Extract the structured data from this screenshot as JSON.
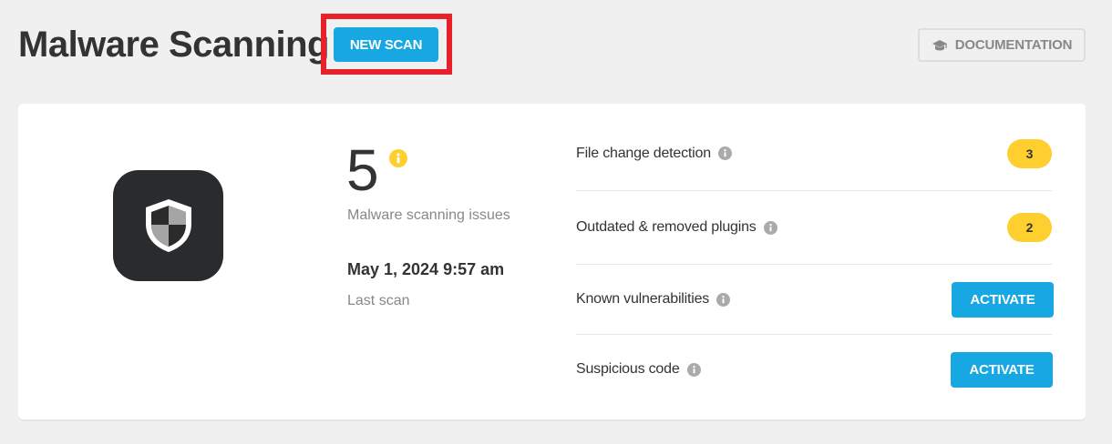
{
  "header": {
    "title": "Malware Scanning",
    "new_scan_label": "NEW SCAN",
    "documentation_label": "DOCUMENTATION"
  },
  "summary": {
    "issue_count": "5",
    "issues_label": "Malware scanning issues",
    "last_scan_date": "May 1, 2024 9:57 am",
    "last_scan_label": "Last scan"
  },
  "checks": [
    {
      "label": "File change detection",
      "badge": "3"
    },
    {
      "label": "Outdated & removed plugins",
      "badge": "2"
    },
    {
      "label": "Known vulnerabilities",
      "action": "ACTIVATE"
    },
    {
      "label": "Suspicious code",
      "action": "ACTIVATE"
    }
  ],
  "icons": {
    "shield": "shield-icon",
    "documentation": "graduation-cap-icon",
    "info": "info-icon"
  },
  "colors": {
    "accent": "#17a8e3",
    "warning": "#fecf2f",
    "highlight": "#e8202a",
    "tile": "#2a2b2d"
  }
}
